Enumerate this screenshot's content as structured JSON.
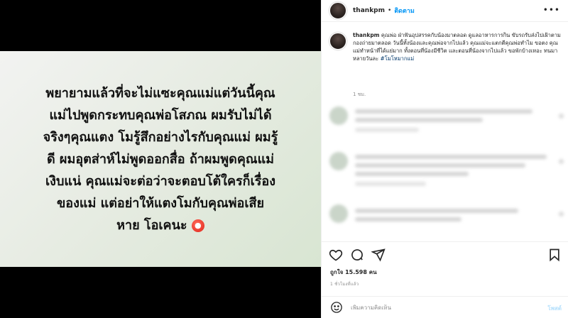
{
  "post": {
    "media_text_lines": [
      "พยายามแล้วที่จะไม่แซะคุณแม่แต่วันนี้คุณ",
      "แม่ไปพูดกระทบคุณพ่อโสภณ ผมรับไม่ได้",
      "จริงๆคุณแตง โมรู้สึกอย่างไรกับคุณแม่ ผมรู้",
      "ดี ผมอุตส่าห์ไม่พูดออกสื่อ ถ้าผมพูดคุณแม่",
      "เงิบแน่ คุณแม่จะต่อว่าจะตอบโต้ใครก็เรื่อง",
      "ของแม่ แต่อย่าให้แตงโมกับคุณพ่อเสีย",
      "หาย โอเคนะ"
    ],
    "media_emoji_icon": "angry-face-emoji"
  },
  "header": {
    "username": "thankpm",
    "separator": "•",
    "follow_label": "ติดตาม",
    "more_icon": "more-horizontal-icon"
  },
  "caption": {
    "username": "thankpm",
    "text": "คุณพ่อ ฝ่าฟันอุปสรรคกับน้องมาตลอด ดูแลอาหารการกิน ขับรถรับส่งไปเฝ้าตามกองถ่ายมาตลอด วันนี้ทั้งน้องและคุณพ่อจากไปแล้ว คุณแม่จะแตกตีคุณพ่อทำไม ขอตง คุณแม่ทำหน้าที่ได้แย่มาก ทั้งตอนที่น้องมีชีวิต และตอนที่น้องจากไปแล้ว ขอพักบ้างเหอะ ทนมาหลายวันละ",
    "hashtag": "#โมโหมากแม่",
    "time": "1 ชม."
  },
  "actions": {
    "like_icon": "heart-icon",
    "comment_icon": "comment-icon",
    "share_icon": "paper-plane-icon",
    "save_icon": "bookmark-icon"
  },
  "stats": {
    "likes_text": "ถูกใจ 15.598 คน",
    "post_time": "1 ชั่วโมงที่แล้ว"
  },
  "comment_box": {
    "placeholder": "เพิ่มความคิดเห็น",
    "post_label": "โพสต์",
    "emoji_icon": "smile-icon"
  },
  "colors": {
    "accent_blue": "#0095f6",
    "post_disabled": "#b2dffc",
    "hashtag": "#00376b",
    "muted": "#8e8e8e"
  }
}
